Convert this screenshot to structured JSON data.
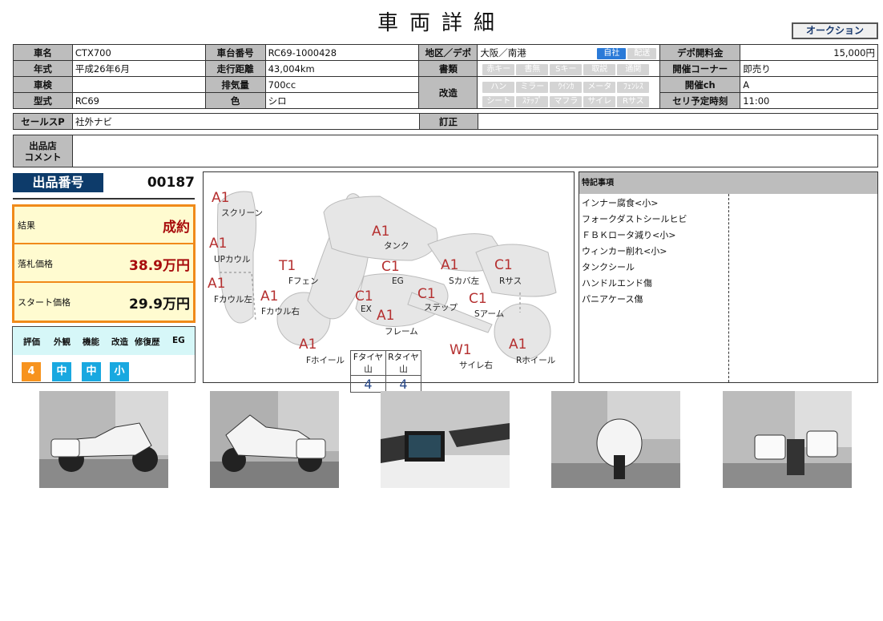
{
  "header": {
    "title": "車両詳細",
    "auction_button": "オークション"
  },
  "info": {
    "name_label": "車名",
    "name": "CTX700",
    "frame_label": "車台番号",
    "frame": "RC69-1000428",
    "region_label": "地区／デポ",
    "region": "大阪／南港",
    "region_chip_self": "自社",
    "region_chip_delivery": "配送",
    "fee_label": "デポ開料金",
    "fee": "15,000円",
    "year_label": "年式",
    "year": "平成26年6月",
    "mileage_label": "走行距離",
    "mileage": "43,004km",
    "docs_label": "書類",
    "docs_chips": [
      "赤キー",
      "書無",
      "Sキー",
      "取説",
      "通関"
    ],
    "corner_label": "開催コーナー",
    "corner": "即売り",
    "inspection_label": "車検",
    "inspection": "",
    "cc_label": "排気量",
    "cc": "700cc",
    "mod_label": "改造",
    "mod_chips_row1": [
      "ハン",
      "ミラー",
      "ｳｲﾝｶ",
      "メータ",
      "ﾌｪﾝﾚｽ"
    ],
    "mod_chips_row2": [
      "シート",
      "ｽﾃｯﾌﾟ",
      "マフラ",
      "サイレ",
      "Rサス"
    ],
    "ch_label": "開催ch",
    "ch": "A",
    "model_label": "型式",
    "model": "RC69",
    "color_label": "色",
    "color": "シロ",
    "sale_time_label": "セリ予定時刻",
    "sale_time": "11:00",
    "salespoint_label": "セールスP",
    "salespoint": "社外ナビ",
    "correction_label": "訂正",
    "correction": "",
    "comment_label_1": "出品店",
    "comment_label_2": "コメント",
    "comment": ""
  },
  "lot": {
    "label": "出品番号",
    "number": "00187"
  },
  "result": {
    "result_label": "結果",
    "result_value": "成約",
    "winning_label": "落札価格",
    "winning_value": "38.9万円",
    "start_label": "スタート価格",
    "start_value": "29.9万円"
  },
  "evaluation": {
    "headers": [
      "評価",
      "外観",
      "機能",
      "改造",
      "修復歴",
      "EG"
    ],
    "values": [
      "4",
      "中",
      "中",
      "小"
    ],
    "colors": {
      "score": "#f7931e",
      "grade": "#19a8e0"
    }
  },
  "diagram": {
    "marks": [
      {
        "code": "A1",
        "label": "スクリーン"
      },
      {
        "code": "A1",
        "label": "UPカウル"
      },
      {
        "code": "A1",
        "label": "Fカウル左"
      },
      {
        "code": "T1",
        "label": "Fフェン"
      },
      {
        "code": "A1",
        "label": "Fカウル右"
      },
      {
        "code": "A1",
        "label": "タンク"
      },
      {
        "code": "C1",
        "label": "EG"
      },
      {
        "code": "C1",
        "label": "EX"
      },
      {
        "code": "A1",
        "label": "フレーム"
      },
      {
        "code": "C1",
        "label": "ステップ"
      },
      {
        "code": "A1",
        "label": "Sカバ左"
      },
      {
        "code": "C1",
        "label": "Rサス"
      },
      {
        "code": "C1",
        "label": "Sアーム"
      },
      {
        "code": "A1",
        "label": "Fホイール"
      },
      {
        "code": "W1",
        "label": "サイレ右"
      },
      {
        "code": "A1",
        "label": "Rホイール"
      }
    ],
    "tire_front_label": "Fタイヤ山",
    "tire_rear_label": "Rタイヤ山",
    "tire_front": "4",
    "tire_rear": "4"
  },
  "notes": {
    "header": "特記事項",
    "items": [
      "インナー腐食<小>",
      "フォークダストシールヒビ",
      "ＦＢＫロータ減り<小>",
      "ウィンカー削れ<小>",
      "タンクシール",
      "ハンドルエンド傷",
      "パニアケース傷"
    ]
  }
}
